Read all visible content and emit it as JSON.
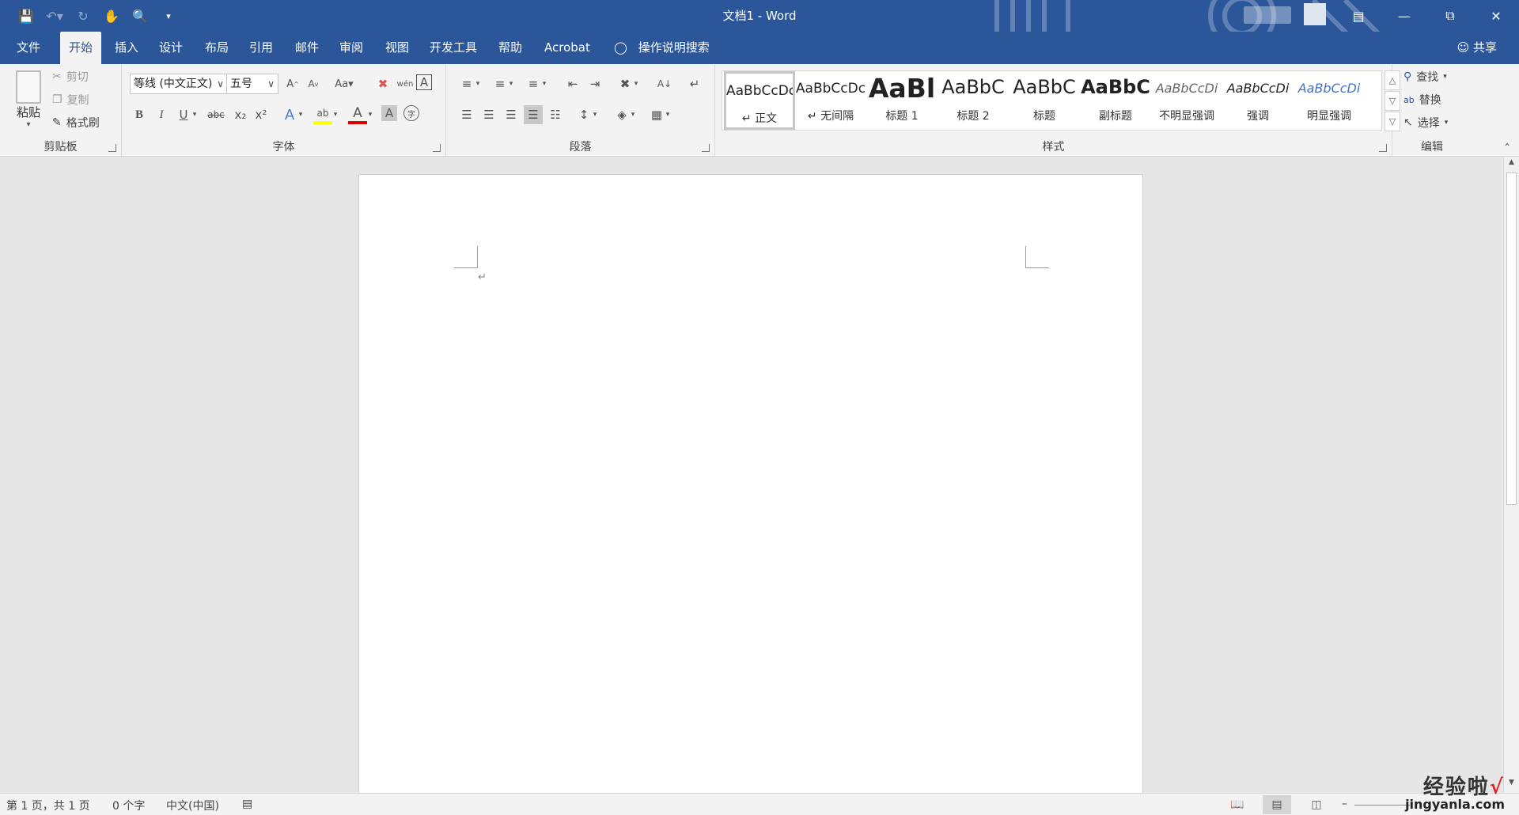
{
  "window": {
    "title": "文档1  -  Word"
  },
  "qat": {
    "save": "save-icon",
    "undo": "undo-icon",
    "redo": "redo-icon",
    "touch": "touch-mode-icon",
    "preview": "print-preview-icon",
    "customize": "customize-qat-icon"
  },
  "tabs": [
    {
      "label": "文件"
    },
    {
      "label": "开始"
    },
    {
      "label": "插入"
    },
    {
      "label": "设计"
    },
    {
      "label": "布局"
    },
    {
      "label": "引用"
    },
    {
      "label": "邮件"
    },
    {
      "label": "审阅"
    },
    {
      "label": "视图"
    },
    {
      "label": "开发工具"
    },
    {
      "label": "帮助"
    },
    {
      "label": "Acrobat"
    }
  ],
  "tell_me": "操作说明搜索",
  "share": "共享",
  "clipboard": {
    "paste": "粘贴",
    "cut": "剪切",
    "copy": "复制",
    "format_painter": "格式刷",
    "label": "剪贴板"
  },
  "font": {
    "name": "等线 (中文正文)",
    "size": "五号",
    "label": "字体",
    "bold": "B",
    "italic": "I",
    "underline": "U",
    "strike": "abc",
    "sub": "x₂",
    "sup": "x²",
    "grow": "A",
    "shrink": "A",
    "case": "Aa",
    "phonetic": "wén",
    "effect": "A",
    "highlight": "ab",
    "color": "A",
    "shade": "A",
    "enclose": "字",
    "border": "A"
  },
  "paragraph": {
    "label": "段落"
  },
  "styles": {
    "label": "样式",
    "items": [
      {
        "sample": "AaBbCcDc",
        "name": "↵ 正文"
      },
      {
        "sample": "AaBbCcDc",
        "name": "↵ 无间隔"
      },
      {
        "sample": "AaBl",
        "name": "标题 1"
      },
      {
        "sample": "AaBbC",
        "name": "标题 2"
      },
      {
        "sample": "AaBbC",
        "name": "标题"
      },
      {
        "sample": "AaBbC",
        "name": "副标题"
      },
      {
        "sample": "AaBbCcDi",
        "name": "不明显强调"
      },
      {
        "sample": "AaBbCcDi",
        "name": "强调"
      },
      {
        "sample": "AaBbCcDi",
        "name": "明显强调"
      }
    ]
  },
  "editing": {
    "find": "查找",
    "replace": "替换",
    "select": "选择",
    "label": "编辑"
  },
  "status": {
    "page": "第 1 页，共 1 页",
    "words": "0 个字",
    "language": "中文(中国)"
  },
  "document": {
    "paragraph_mark": "↵"
  },
  "watermark": {
    "cn": "经验啦",
    "check": "√",
    "url": "jingyanla.com"
  },
  "colors": {
    "accent": "#2b579a",
    "highlight": "#ffff00",
    "font_color": "#e00000"
  }
}
